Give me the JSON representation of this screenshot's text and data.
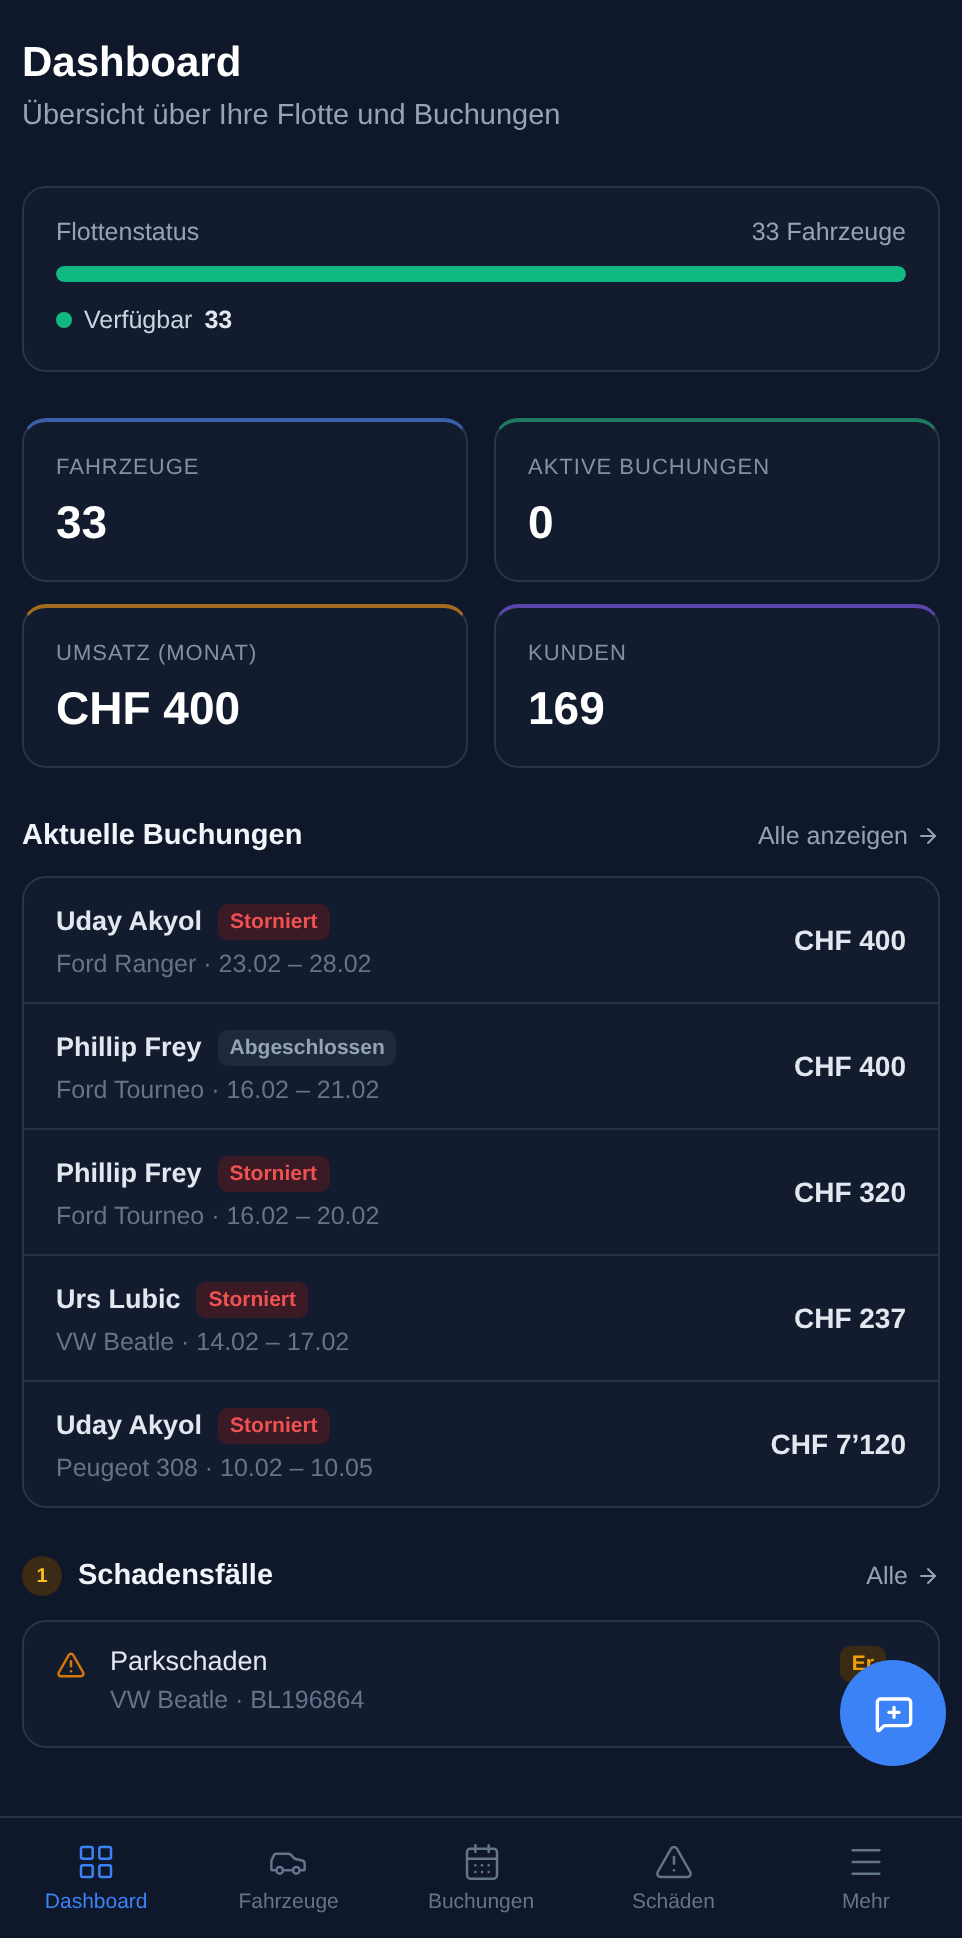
{
  "header": {
    "title": "Dashboard",
    "subtitle": "Übersicht über Ihre Flotte und Buchungen"
  },
  "fleet": {
    "label": "Flottenstatus",
    "total": "33 Fahrzeuge",
    "level": 1,
    "legend": [
      {
        "label": "Verfügbar",
        "count": "33",
        "color": "#10b981"
      }
    ]
  },
  "stats": [
    {
      "label": "FAHRZEUGE",
      "value": "33",
      "color": "#3b5fa8"
    },
    {
      "label": "AKTIVE BUCHUNGEN",
      "value": "0",
      "color": "#1f7a62"
    },
    {
      "label": "UMSATZ (MONAT)",
      "value": "CHF 400",
      "color": "#a36b1f"
    },
    {
      "label": "KUNDEN",
      "value": "169",
      "color": "#5b45a8"
    }
  ],
  "bookings": {
    "title": "Aktuelle Buchungen",
    "link": "Alle anzeigen",
    "rows": [
      {
        "name": "Uday Akyol",
        "status": "Storniert",
        "kind": "cancelled",
        "detail": "Ford Ranger · 23.02 – 28.02",
        "amount": "CHF 400"
      },
      {
        "name": "Phillip Frey",
        "status": "Abgeschlossen",
        "kind": "completed",
        "detail": "Ford Tourneo · 16.02 – 21.02",
        "amount": "CHF 400"
      },
      {
        "name": "Phillip Frey",
        "status": "Storniert",
        "kind": "cancelled",
        "detail": "Ford Tourneo · 16.02 – 20.02",
        "amount": "CHF 320"
      },
      {
        "name": "Urs Lubic",
        "status": "Storniert",
        "kind": "cancelled",
        "detail": "VW Beatle · 14.02 – 17.02",
        "amount": "CHF 237"
      },
      {
        "name": "Uday Akyol",
        "status": "Storniert",
        "kind": "cancelled",
        "detail": "Peugeot 308 · 10.02 – 10.05",
        "amount": "CHF 7’120"
      }
    ]
  },
  "damages": {
    "count": "1",
    "title": "Schadensfälle",
    "link": "Alle",
    "items": [
      {
        "title": "Parkschaden",
        "detail": "VW Beatle · BL196864",
        "status": "Er"
      }
    ]
  },
  "nav": [
    {
      "label": "Dashboard",
      "selected": true
    },
    {
      "label": "Fahrzeuge",
      "selected": false
    },
    {
      "label": "Buchungen",
      "selected": false
    },
    {
      "label": "Schäden",
      "selected": false
    },
    {
      "label": "Mehr",
      "selected": false
    }
  ]
}
